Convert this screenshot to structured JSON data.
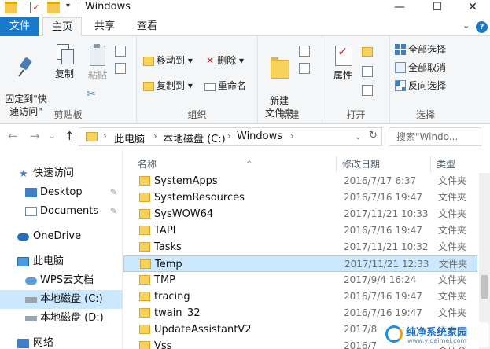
{
  "window": {
    "title": "Windows",
    "controls": {
      "minimize": "—",
      "maximize": "☐",
      "close": "✕"
    }
  },
  "ribbon": {
    "tabs": {
      "file": "文件",
      "home": "主页",
      "share": "共享",
      "view": "查看"
    },
    "clipboard": {
      "pin": "固定到\"快\n速访问\"",
      "copy": "复制",
      "paste": "粘贴",
      "group": "剪贴板"
    },
    "organize": {
      "move_to": "移动到 ▾",
      "copy_to": "复制到 ▾",
      "delete": "删除 ▾",
      "rename": "重命名",
      "group": "组织"
    },
    "new": {
      "new_folder": "新建\n文件夹",
      "group": "新建"
    },
    "open": {
      "properties": "属性",
      "group": "打开"
    },
    "select": {
      "select_all": "全部选择",
      "select_none": "全部取消",
      "invert": "反向选择",
      "group": "选择"
    }
  },
  "address": {
    "crumbs": [
      "此电脑",
      "本地磁盘 (C:)",
      "Windows"
    ],
    "search_placeholder": "搜索\"Windo..."
  },
  "sidebar": {
    "items": [
      {
        "label": "快速访问",
        "icon": "star-icon"
      },
      {
        "label": "Desktop",
        "icon": "desktop-icon"
      },
      {
        "label": "Documents",
        "icon": "documents-icon"
      },
      {
        "label": "OneDrive",
        "icon": "cloud-icon"
      },
      {
        "label": "此电脑",
        "icon": "computer-icon"
      },
      {
        "label": "WPS云文档",
        "icon": "cloud-doc-icon"
      },
      {
        "label": "本地磁盘 (C:)",
        "icon": "drive-icon"
      },
      {
        "label": "本地磁盘 (D:)",
        "icon": "drive-icon"
      },
      {
        "label": "网络",
        "icon": "network-icon"
      }
    ]
  },
  "list": {
    "columns": {
      "name": "名称",
      "modified": "修改日期",
      "type": "类型"
    },
    "rows": [
      {
        "name": "SystemApps",
        "date": "2016/7/17 6:37",
        "type": "文件夹"
      },
      {
        "name": "SystemResources",
        "date": "2016/7/16 19:47",
        "type": "文件夹"
      },
      {
        "name": "SysWOW64",
        "date": "2017/11/21 10:33",
        "type": "文件夹"
      },
      {
        "name": "TAPI",
        "date": "2016/7/16 19:47",
        "type": "文件夹"
      },
      {
        "name": "Tasks",
        "date": "2017/11/21 10:32",
        "type": "文件夹"
      },
      {
        "name": "Temp",
        "date": "2017/11/21 12:33",
        "type": "文件夹"
      },
      {
        "name": "TMP",
        "date": "2017/9/4 16:24",
        "type": "文件夹"
      },
      {
        "name": "tracing",
        "date": "2016/7/16 19:47",
        "type": "文件夹"
      },
      {
        "name": "twain_32",
        "date": "2016/7/16 19:47",
        "type": "文件夹"
      },
      {
        "name": "UpdateAssistantV2",
        "date": "2017/8",
        "type": "文件夹"
      },
      {
        "name": "Vss",
        "date": "2016/7",
        "type": "文件夹"
      }
    ],
    "selected_index": 5
  },
  "watermark": {
    "text": "纯净系统家园",
    "url": "www.yidaimei.com"
  },
  "colors": {
    "accent": "#1979ca",
    "selection": "#cce8ff",
    "folder": "#f6d25b"
  }
}
